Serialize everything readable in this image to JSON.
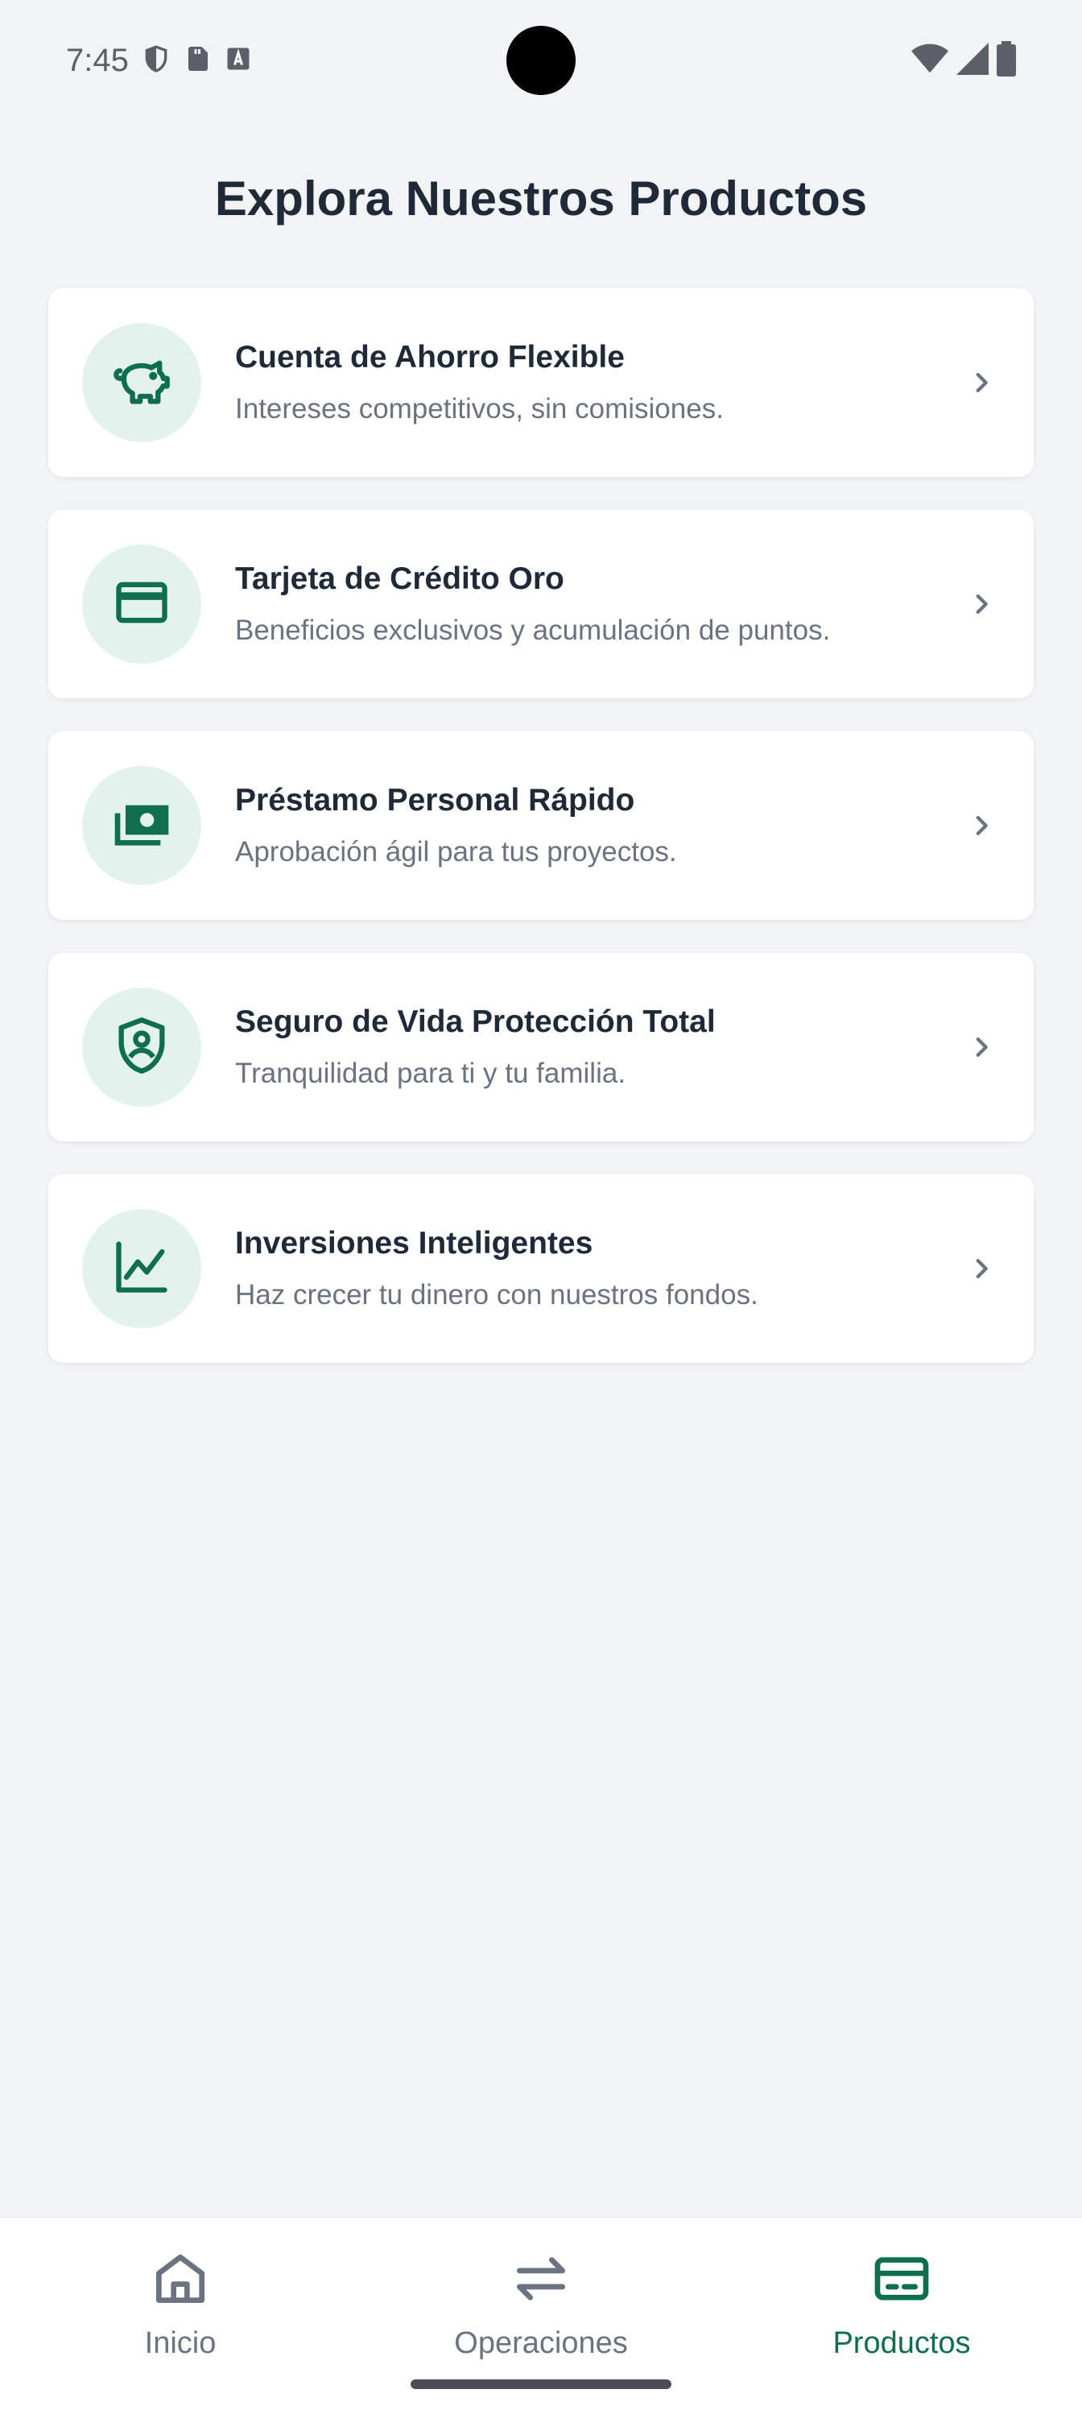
{
  "status_bar": {
    "time": "7:45",
    "left_icons": [
      "shield-icon",
      "sd-card-icon",
      "font-a-icon"
    ],
    "right_icons": [
      "wifi-icon",
      "signal-icon",
      "battery-icon"
    ]
  },
  "page": {
    "title": "Explora Nuestros Productos"
  },
  "products": [
    {
      "icon": "piggy-bank-icon",
      "title": "Cuenta de Ahorro Flexible",
      "subtitle": "Intereses competitivos, sin comisiones."
    },
    {
      "icon": "credit-card-icon",
      "title": "Tarjeta de Crédito Oro",
      "subtitle": "Beneficios exclusivos y acumulación de puntos."
    },
    {
      "icon": "money-bills-icon",
      "title": "Préstamo Personal Rápido",
      "subtitle": "Aprobación ágil para tus proyectos."
    },
    {
      "icon": "shield-person-icon",
      "title": "Seguro de Vida Protección Total",
      "subtitle": "Tranquilidad para ti y tu familia."
    },
    {
      "icon": "trending-chart-icon",
      "title": "Inversiones Inteligentes",
      "subtitle": "Haz crecer tu dinero con nuestros fondos."
    }
  ],
  "bottom_nav": {
    "items": [
      {
        "icon": "home-icon",
        "label": "Inicio",
        "active": false
      },
      {
        "icon": "swap-arrows-icon",
        "label": "Operaciones",
        "active": false
      },
      {
        "icon": "card-icon",
        "label": "Productos",
        "active": true
      }
    ]
  },
  "colors": {
    "accent": "#0f6e4e",
    "icon_bg": "#e4f2ee",
    "background": "#f2f3f5",
    "title_text": "#1f2937",
    "muted_text": "#6b7280"
  }
}
